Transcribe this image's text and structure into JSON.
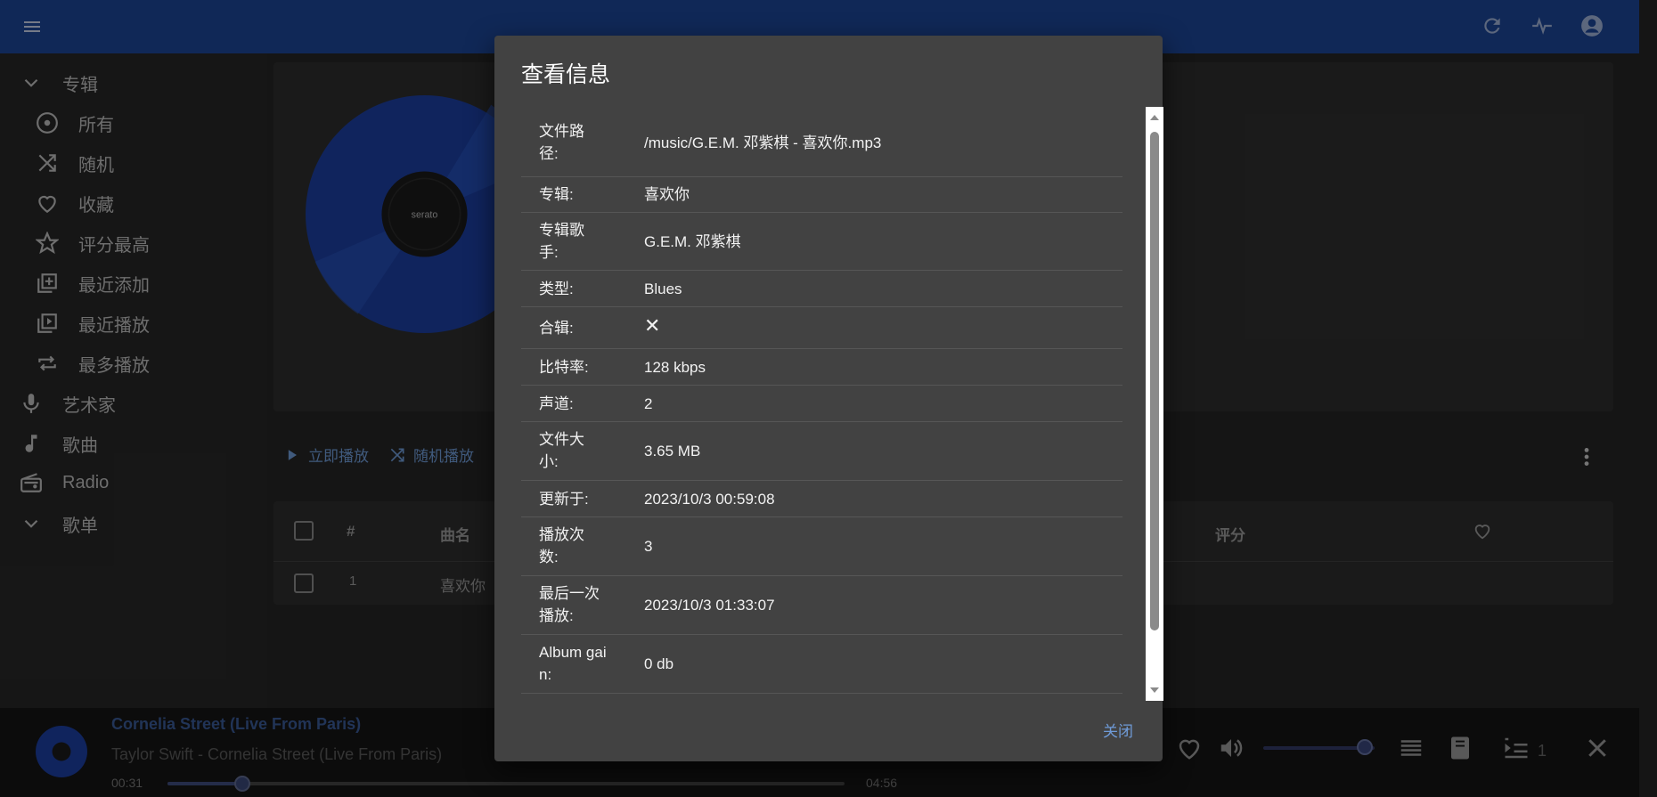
{
  "colors": {
    "appbar": "#1c4596",
    "accent": "#6f9bd8",
    "dialog": "#424242"
  },
  "topbar": {
    "icons": [
      "menu-icon",
      "refresh-icon",
      "activity-icon",
      "account-icon"
    ]
  },
  "sidebar": {
    "albums_label": "专辑",
    "items": [
      {
        "label": "所有",
        "icon": "album-icon"
      },
      {
        "label": "随机",
        "icon": "shuffle-icon"
      },
      {
        "label": "收藏",
        "icon": "heart-icon"
      },
      {
        "label": "评分最高",
        "icon": "star-icon"
      },
      {
        "label": "最近添加",
        "icon": "library-add-icon"
      },
      {
        "label": "最近播放",
        "icon": "library-play-icon"
      },
      {
        "label": "最多播放",
        "icon": "repeat-icon"
      }
    ],
    "artists_label": "艺术家",
    "songs_label": "歌曲",
    "radio_label": "Radio",
    "playlists_label": "歌单"
  },
  "album": {
    "vinyl_label": "serato",
    "actions": {
      "play_now": "立即播放",
      "shuffle_play": "随机播放"
    },
    "table": {
      "headers": {
        "index": "#",
        "title": "曲名",
        "rating": "评分"
      },
      "rows": [
        {
          "index": "1",
          "title": "喜欢你"
        }
      ]
    }
  },
  "dialog": {
    "title": "查看信息",
    "rows": [
      {
        "label": "文件路径:",
        "value": "/music/G.E.M. 邓紫棋 - 喜欢你.mp3"
      },
      {
        "label": "专辑:",
        "value": "喜欢你"
      },
      {
        "label": "专辑歌手:",
        "value": "G.E.M. 邓紫棋"
      },
      {
        "label": "类型:",
        "value": "Blues"
      },
      {
        "label": "合辑:",
        "value": "✕"
      },
      {
        "label": "比特率:",
        "value": "128 kbps"
      },
      {
        "label": "声道:",
        "value": "2"
      },
      {
        "label": "文件大小:",
        "value": "3.65 MB"
      },
      {
        "label": "更新于:",
        "value": "2023/10/3 00:59:08"
      },
      {
        "label": "播放次数:",
        "value": "3"
      },
      {
        "label": "最后一次播放:",
        "value": "2023/10/3 01:33:07"
      },
      {
        "label": "Album gain:",
        "value": "0 db"
      }
    ],
    "close_label": "关闭"
  },
  "player": {
    "title": "Cornelia Street (Live From Paris)",
    "subtitle": "Taylor Swift - Cornelia Street (Live From Paris)",
    "current_time": "00:31",
    "total_time": "04:56",
    "progress": 0.11,
    "volume": 0.91,
    "queue_count": "1"
  }
}
